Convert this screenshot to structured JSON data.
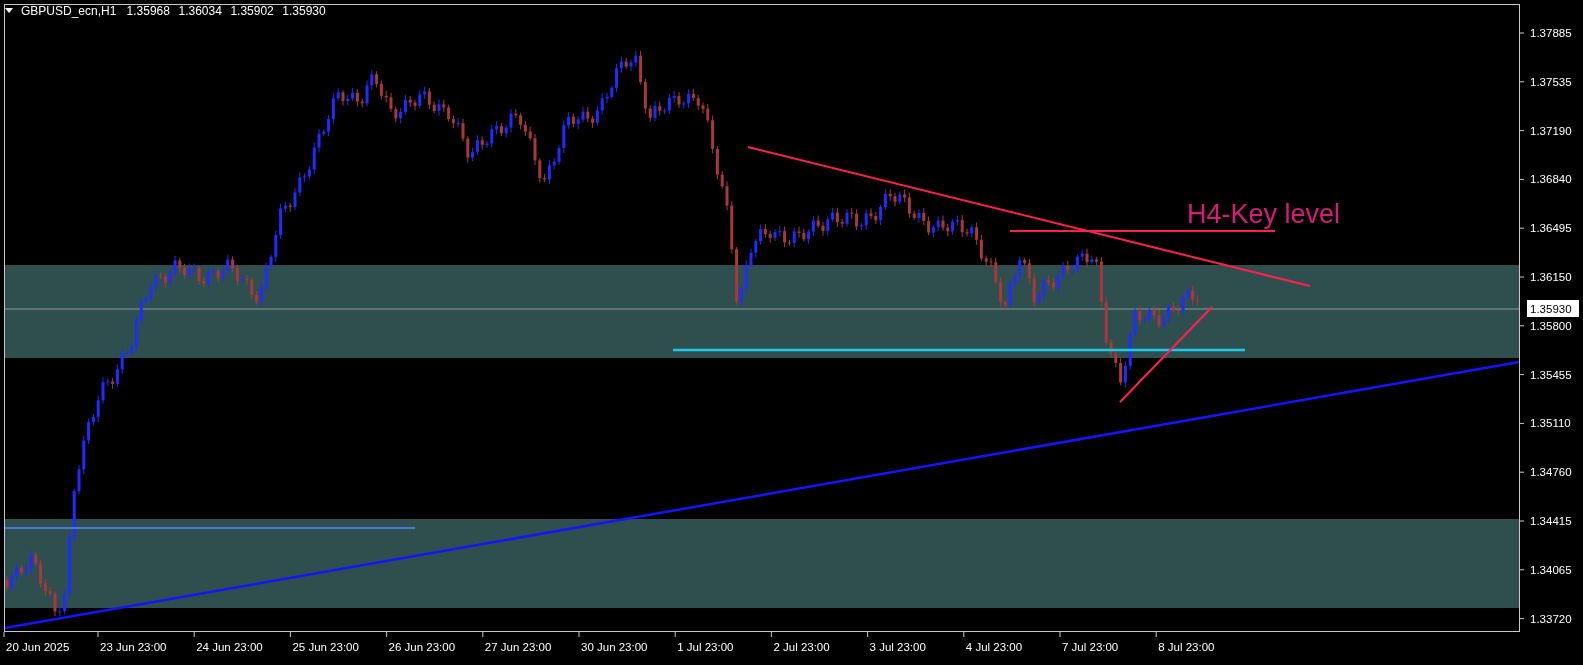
{
  "header": {
    "symbol": "GBPUSD_ecn,H1",
    "quotes": [
      "1.35968",
      "1.36034",
      "1.35902",
      "1.35930"
    ]
  },
  "annotations": [
    {
      "text": "H4-Key level"
    }
  ],
  "price_axis": {
    "ticks": [
      "1.37885",
      "1.37535",
      "1.37190",
      "1.36840",
      "1.36495",
      "1.36150",
      "1.35800",
      "1.35455",
      "1.35110",
      "1.34760",
      "1.34415",
      "1.34065",
      "1.33720"
    ],
    "current_price": "1.35930"
  },
  "time_axis": {
    "labels": [
      "20 Jun 2025",
      "23 Jun 23:00",
      "24 Jun 23:00",
      "25 Jun 23:00",
      "26 Jun 23:00",
      "27 Jun 23:00",
      "30 Jun 23:00",
      "1 Jul 23:00",
      "2 Jul 23:00",
      "3 Jul 23:00",
      "4 Jul 23:00",
      "7 Jul 23:00",
      "8 Jul 23:00"
    ]
  }
}
